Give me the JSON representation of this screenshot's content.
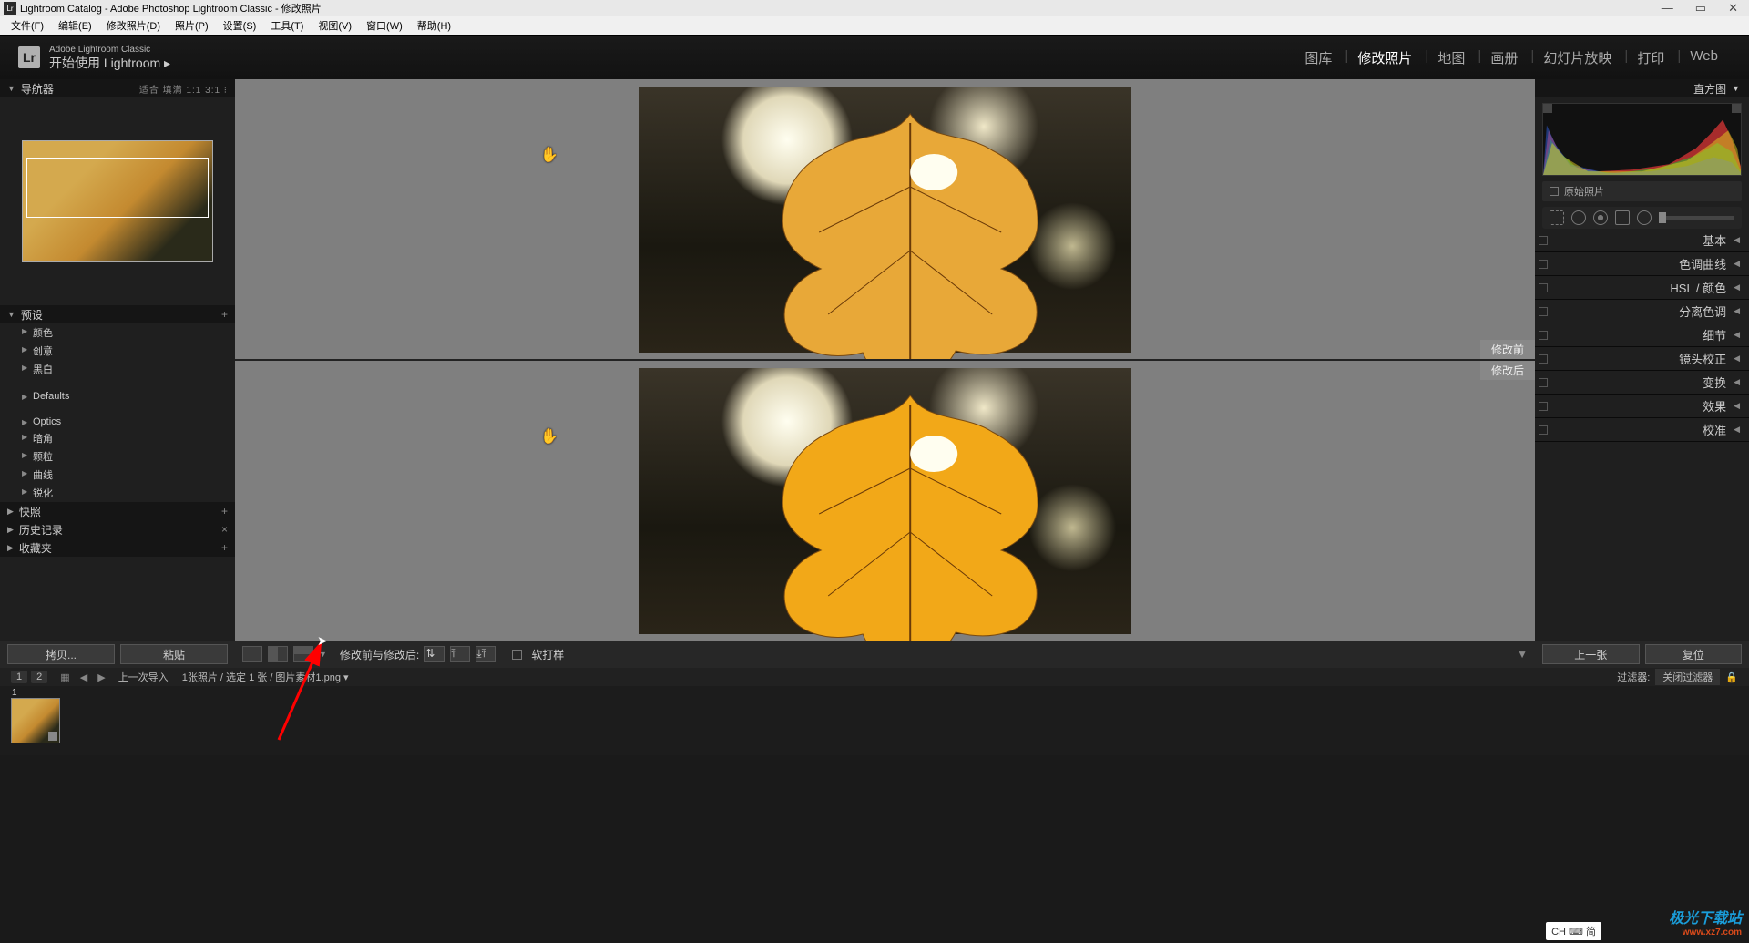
{
  "titlebar": {
    "title": "Lightroom Catalog - Adobe Photoshop Lightroom Classic - 修改照片"
  },
  "menubar": {
    "items": [
      "文件(F)",
      "编辑(E)",
      "修改照片(D)",
      "照片(P)",
      "设置(S)",
      "工具(T)",
      "视图(V)",
      "窗口(W)",
      "帮助(H)"
    ]
  },
  "header": {
    "subtitle": "Adobe Lightroom Classic",
    "title": "开始使用 Lightroom ▸",
    "modules": [
      "图库",
      "修改照片",
      "地图",
      "画册",
      "幻灯片放映",
      "打印",
      "Web"
    ],
    "active_module": "修改照片"
  },
  "left": {
    "navigator": {
      "title": "导航器",
      "zoom": "适合  填满  1:1  3:1 ⁝"
    },
    "presets": {
      "title": "预设",
      "groups": [
        "颜色",
        "创意",
        "黑白"
      ],
      "groups2": [
        "Defaults"
      ],
      "groups3": [
        "Optics",
        "暗角",
        "颗粒",
        "曲线",
        "锐化"
      ]
    },
    "snapshots": "快照",
    "history": "历史记录",
    "collections": "收藏夹",
    "copy": "拷贝...",
    "paste": "粘贴"
  },
  "center": {
    "before": "修改前",
    "after": "修改后",
    "toolbar_label": "修改前与修改后:",
    "softproof": "软打样"
  },
  "right": {
    "histogram": "直方图",
    "original": "原始照片",
    "panels": [
      "基本",
      "色调曲线",
      "HSL / 颜色",
      "分离色调",
      "细节",
      "镜头校正",
      "变换",
      "效果",
      "校准"
    ],
    "prev": "上一张",
    "reset": "复位"
  },
  "filterbar": {
    "chips": [
      "1",
      "2"
    ],
    "context": "上一次导入",
    "count": "1张照片 / 选定 1 张 / 图片素材1.png ▾",
    "filter_label": "过滤器:",
    "filter_value": "关闭过滤器"
  },
  "watermark": {
    "brand": "极光下载站",
    "url": "www.xz7.com"
  },
  "ime": "CH ⌨ 简"
}
